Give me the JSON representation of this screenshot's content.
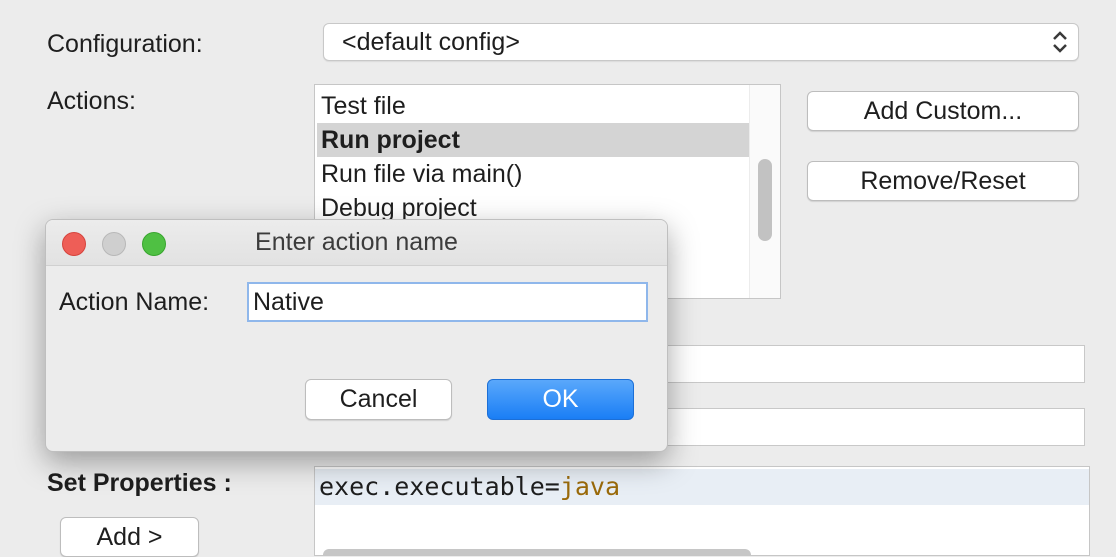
{
  "configuration": {
    "label": "Configuration:",
    "selected": "<default config>"
  },
  "actions": {
    "label": "Actions:",
    "items": [
      {
        "label": "Test file",
        "selected": false
      },
      {
        "label": "Run project",
        "selected": true
      },
      {
        "label": "Run file via main()",
        "selected": false
      },
      {
        "label": "Debug project",
        "selected": false
      }
    ],
    "add_custom_label": "Add Custom...",
    "remove_reset_label": "Remove/Reset"
  },
  "properties": {
    "label": "Set Properties :",
    "key_text": "exec.executable=",
    "value_text": "java",
    "add_label": "Add >"
  },
  "dialog": {
    "title": "Enter action name",
    "field_label": "Action Name:",
    "field_value": "Native",
    "cancel_label": "Cancel",
    "ok_label": "OK"
  },
  "colors": {
    "accent": "#1a7ef5",
    "property_value": "#9a6a0a"
  }
}
